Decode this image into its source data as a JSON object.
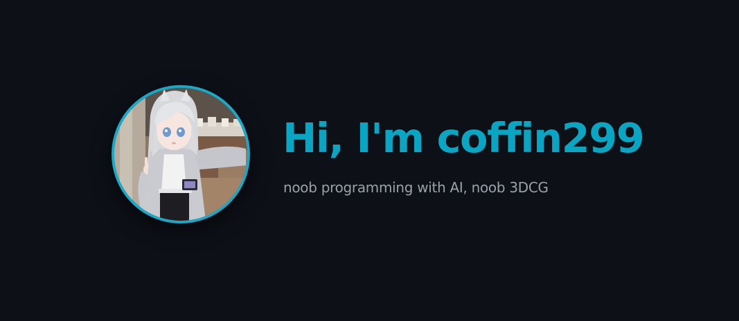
{
  "profile": {
    "greeting": "Hi, I'm coffin299",
    "tagline": "noob programming with AI, noob 3DCG",
    "avatar_alt": "coffin299 avatar",
    "accent_color": "#0aa5c2",
    "background_color": "#0d1017",
    "tagline_color": "#9aa1ab"
  }
}
